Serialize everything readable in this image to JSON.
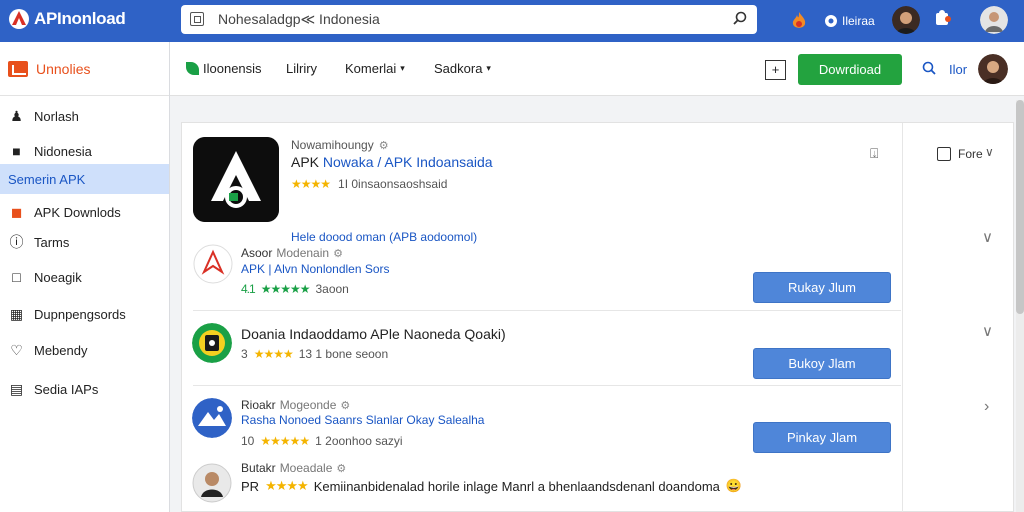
{
  "topbar": {
    "brand": "APInonload",
    "url": "Nohesaladgp≪ Indonesia",
    "chat_label": "Ileiraa"
  },
  "sidebar": {
    "header": "Unnolies",
    "items": [
      {
        "label": "Norlash",
        "icon": "person-icon"
      },
      {
        "label": "Nidonesia",
        "icon": "briefcase-icon"
      },
      {
        "label": "Semerin APK",
        "icon": "",
        "active": true
      },
      {
        "label": "APK Downlods",
        "icon": "apk-icon"
      },
      {
        "label": "Tarms",
        "icon": "info-icon"
      },
      {
        "label": "Noeagik",
        "icon": "chat-icon"
      },
      {
        "label": "Dupnpengsords",
        "icon": "grid-icon"
      },
      {
        "label": "Mebendy",
        "icon": "heart-icon"
      },
      {
        "label": "Sedia IAPs",
        "icon": "document-icon"
      }
    ]
  },
  "subnav": {
    "items": [
      {
        "label": "Iloonensis",
        "caret": ""
      },
      {
        "label": "Lilriry",
        "caret": ""
      },
      {
        "label": "Komerlai",
        "caret": "▾"
      },
      {
        "label": "Sadkora",
        "caret": "▾"
      }
    ],
    "box_label": "+",
    "download_label": "Dowrdioad",
    "right_label": "Ilor"
  },
  "hero": {
    "meta": "Nowamihoungy",
    "title_dark": "APK",
    "title_blue": "Nowaka / APK Indoansaida",
    "stars": "★★★★",
    "rating_text": "1I  0insaonsaoshsaid",
    "pin": "⍗",
    "filter_label": "Fore",
    "filter_caret": "∨"
  },
  "section_link": "Hele doood oman (APB aodoomol)",
  "apps": [
    {
      "meta": "Asoor",
      "meta_sub": "Modenain",
      "sub": "APK | Alvn Nonlondlen Sors",
      "stars_prefix": "4.1",
      "stars": "★★★★★",
      "rate_text": "3aoon",
      "button": "Rukay Jlum"
    },
    {
      "title": "Doania Indaoddamo APle Naoneda Qoaki)",
      "stars_prefix": "3",
      "stars": "★★★★",
      "rate_text": "13 1 bone seoon",
      "button": "Bukoy Jlam"
    },
    {
      "meta": "Rioakr",
      "meta_sub": "Mogeonde",
      "sub": "Rasha Nonoed Saanrs Slanlar Okay Salealha",
      "stars_prefix": "10",
      "stars": "★★★★★",
      "rate_text": "1 2oonhoo sazyi",
      "button": "Pinkay Jlam"
    },
    {
      "meta": "Butakr",
      "meta_sub": "Moeadale",
      "prefix": "PR",
      "stars": "★★★★",
      "desc": "Kemiinanbidenalad horile inlage Manrl a bhenlaandsdenanl doandoma",
      "emoji": "😀"
    }
  ],
  "colors": {
    "topbar": "#2f62c6",
    "accent_blue": "#1a56c4",
    "green": "#23a33f",
    "orange": "#e8501c",
    "button_blue": "#4f86d9",
    "star_yellow": "#f4b400"
  }
}
